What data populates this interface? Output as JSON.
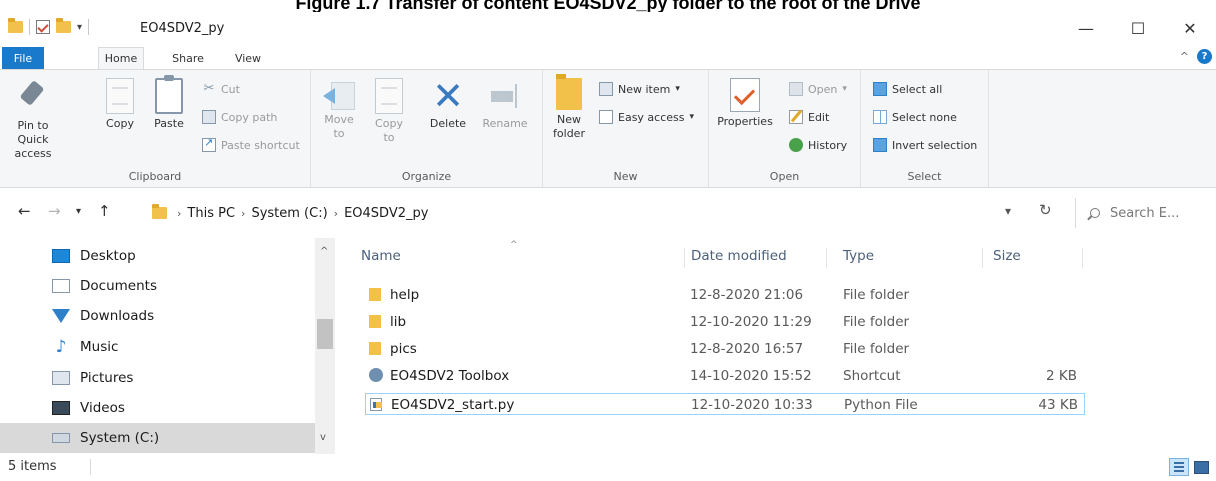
{
  "caption": "Figure 1.7 Transfer of content EO4SDV2_py folder to the root of the  Drive",
  "window": {
    "title": "EO4SDV2_py",
    "controls": {
      "minimize": "—",
      "maximize": "☐",
      "close": "✕"
    }
  },
  "ribbon_tabs": {
    "file": "File",
    "home": "Home",
    "share": "Share",
    "view": "View"
  },
  "ribbon": {
    "clipboard": {
      "label": "Clipboard",
      "pin": "Pin to Quick access",
      "copy": "Copy",
      "paste": "Paste",
      "cut": "Cut",
      "copy_path": "Copy path",
      "paste_shortcut": "Paste shortcut"
    },
    "organize": {
      "label": "Organize",
      "move_to": "Move to",
      "copy_to": "Copy to",
      "delete": "Delete",
      "rename": "Rename"
    },
    "new": {
      "label": "New",
      "new_folder": "New folder",
      "new_item": "New item",
      "easy_access": "Easy access"
    },
    "open": {
      "label": "Open",
      "properties": "Properties",
      "open": "Open",
      "edit": "Edit",
      "history": "History"
    },
    "select": {
      "label": "Select",
      "select_all": "Select all",
      "select_none": "Select none",
      "invert_selection": "Invert selection"
    }
  },
  "address": {
    "crumbs": [
      "This PC",
      "System (C:)",
      "EO4SDV2_py"
    ],
    "search_placeholder": "Search E..."
  },
  "nav_items": [
    {
      "label": "Desktop",
      "icon": "desktop-icon"
    },
    {
      "label": "Documents",
      "icon": "documents-icon"
    },
    {
      "label": "Downloads",
      "icon": "downloads-icon"
    },
    {
      "label": "Music",
      "icon": "music-icon"
    },
    {
      "label": "Pictures",
      "icon": "pictures-icon"
    },
    {
      "label": "Videos",
      "icon": "videos-icon"
    },
    {
      "label": "System (C:)",
      "icon": "drive-icon",
      "selected": true
    }
  ],
  "columns": {
    "name": "Name",
    "date": "Date modified",
    "type": "Type",
    "size": "Size"
  },
  "files": [
    {
      "name": "help",
      "date": "12-8-2020 21:06",
      "type": "File folder",
      "size": "",
      "icon": "folder-icon"
    },
    {
      "name": "lib",
      "date": "12-10-2020 11:29",
      "type": "File folder",
      "size": "",
      "icon": "folder-icon"
    },
    {
      "name": "pics",
      "date": "12-8-2020 16:57",
      "type": "File folder",
      "size": "",
      "icon": "folder-icon"
    },
    {
      "name": "EO4SDV2 Toolbox",
      "date": "14-10-2020 15:52",
      "type": "Shortcut",
      "size": "2 KB",
      "icon": "toolbox-shortcut-icon"
    },
    {
      "name": "EO4SDV2_start.py",
      "date": "12-10-2020 10:33",
      "type": "Python File",
      "size": "43 KB",
      "icon": "python-file-icon",
      "selected": true
    }
  ],
  "status": {
    "count": "5 items"
  },
  "colors": {
    "accent": "#1979ca",
    "selection_border": "#99d1ff",
    "nav_selected": "#d9d9d9"
  }
}
